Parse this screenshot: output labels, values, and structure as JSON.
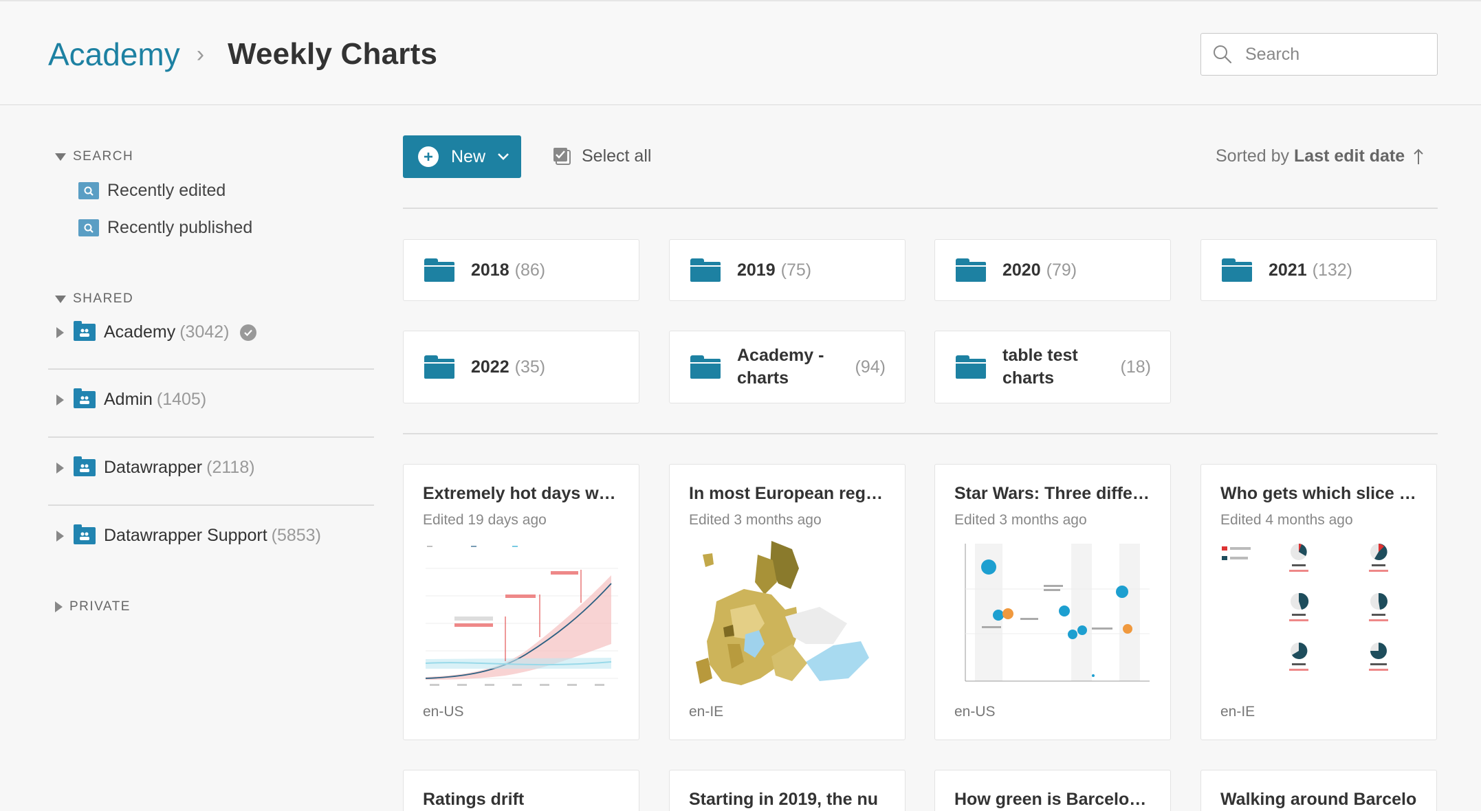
{
  "breadcrumb": {
    "root": "Academy",
    "separator": "›",
    "current": "Weekly Charts"
  },
  "search": {
    "placeholder": "Search"
  },
  "sidebar": {
    "search_heading": "SEARCH",
    "search_items": [
      {
        "label": "Recently edited"
      },
      {
        "label": "Recently published"
      }
    ],
    "shared_heading": "SHARED",
    "shared_items": [
      {
        "label": "Academy",
        "count": "(3042)"
      },
      {
        "label": "Admin",
        "count": "(1405)"
      },
      {
        "label": "Datawrapper",
        "count": "(2118)"
      },
      {
        "label": "Datawrapper Support",
        "count": "(5853)"
      }
    ],
    "private_heading": "PRIVATE"
  },
  "toolbar": {
    "new_label": "New",
    "select_all_label": "Select all",
    "sorted_prefix": "Sorted by",
    "sorted_field": "Last edit date"
  },
  "folders": [
    {
      "name": "2018",
      "count": "(86)"
    },
    {
      "name": "2019",
      "count": "(75)"
    },
    {
      "name": "2020",
      "count": "(79)"
    },
    {
      "name": "2021",
      "count": "(132)"
    },
    {
      "name": "2022",
      "count": "(35)"
    },
    {
      "name_line1": "Academy -",
      "name_line2": "charts",
      "count": "(94)"
    },
    {
      "name_line1": "table test",
      "name_line2": "charts",
      "count": "(18)"
    }
  ],
  "charts": [
    {
      "title": "Extremely hot days will …",
      "edited": "Edited 19 days ago",
      "locale": "en-US"
    },
    {
      "title": "In most European regio…",
      "edited": "Edited 3 months ago",
      "locale": "en-IE"
    },
    {
      "title": "Star Wars: Three differe…",
      "edited": "Edited 3 months ago",
      "locale": "en-US"
    },
    {
      "title": "Who gets which slice of…",
      "edited": "Edited 4 months ago",
      "locale": "en-IE"
    }
  ],
  "charts_partial": [
    {
      "title": "Ratings drift"
    },
    {
      "title": "Starting in 2019, the nu"
    },
    {
      "title": "How green is Barcelona?"
    },
    {
      "title": "Walking around Barcelo"
    }
  ],
  "colors": {
    "accent": "#1d81a2",
    "link": "#1d81a2"
  }
}
